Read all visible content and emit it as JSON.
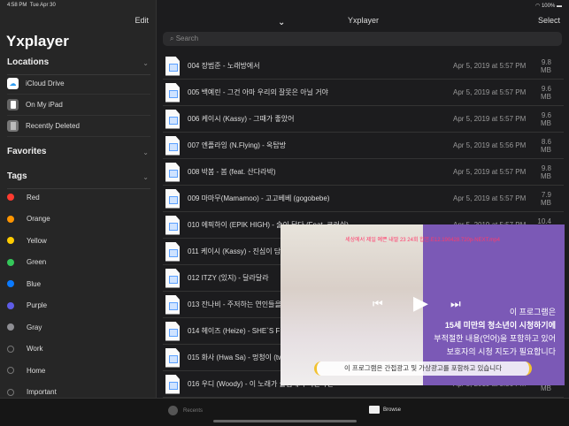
{
  "status": {
    "time": "4:58 PM",
    "date": "Tue Apr 30",
    "battery": "100%"
  },
  "sidebar": {
    "edit": "Edit",
    "title": "Yxplayer",
    "locations_header": "Locations",
    "locations": [
      {
        "label": "iCloud Drive",
        "icon": "cloud-icon"
      },
      {
        "label": "On My iPad",
        "icon": "ipad-icon"
      },
      {
        "label": "Recently Deleted",
        "icon": "trash-icon"
      }
    ],
    "favorites_header": "Favorites",
    "tags_header": "Tags",
    "tags": [
      {
        "label": "Red",
        "color": "#ff3b30"
      },
      {
        "label": "Orange",
        "color": "#ff9500"
      },
      {
        "label": "Yellow",
        "color": "#ffcc00"
      },
      {
        "label": "Green",
        "color": "#34c759"
      },
      {
        "label": "Blue",
        "color": "#0a7aff"
      },
      {
        "label": "Purple",
        "color": "#5e5ce6"
      },
      {
        "label": "Gray",
        "color": "#8e8e93"
      },
      {
        "label": "Work",
        "color": ""
      },
      {
        "label": "Home",
        "color": ""
      },
      {
        "label": "Important",
        "color": ""
      }
    ]
  },
  "main": {
    "title": "Yxplayer",
    "select": "Select",
    "search_placeholder": "Search",
    "files": [
      {
        "name": "004 장범준 - 노래방에서",
        "date": "Apr 5, 2019 at 5:57 PM",
        "size": "9.8 MB"
      },
      {
        "name": "005 백예린 - 그건 아마 우리의 잘못은 아닐 거야",
        "date": "Apr 5, 2019 at 5:57 PM",
        "size": "9.6 MB"
      },
      {
        "name": "006 케이시 (Kassy) - 그때가 좋았어",
        "date": "Apr 5, 2019 at 5:57 PM",
        "size": "9.6 MB"
      },
      {
        "name": "007 엔플라잉 (N.Flying) - 옥탑방",
        "date": "Apr 5, 2019 at 5:56 PM",
        "size": "8.6 MB"
      },
      {
        "name": "008 박봄 - 봄 (feat. 산다라박)",
        "date": "Apr 5, 2019 at 5:57 PM",
        "size": "9.8 MB"
      },
      {
        "name": "009 마마무(Mamamoo) - 고고베베 (gogobebe)",
        "date": "Apr 5, 2019 at 5:57 PM",
        "size": "7.9 MB"
      },
      {
        "name": "010 에픽하이 (EPIK HIGH) - 술이 달다 (Feat. 크러쉬)",
        "date": "Apr 5, 2019 at 5:57 PM",
        "size": "10.4 MB"
      },
      {
        "name": "011 케이시 (Kassy) - 진심이 담",
        "date": "",
        "size": ""
      },
      {
        "name": "012 ITZY (있지) - 달라달라",
        "date": "",
        "size": ""
      },
      {
        "name": "013 잔나비 - 주저하는 연인들을",
        "date": "",
        "size": ""
      },
      {
        "name": "014 헤이즈 (Heize) - SHE`S F",
        "date": "",
        "size": ""
      },
      {
        "name": "015 화사 (Hwa Sa) - 멍청이 (tw",
        "date": "",
        "size": ""
      },
      {
        "name": "016 우디 (Woody) - 이 노래가 클럽에서 나온다면",
        "date": "Apr 5, 2019 at 5:56 PM",
        "size": "8.8 MB"
      }
    ]
  },
  "video": {
    "title": "세상에서 제일 예쁜 내딸 23 24회 합본.E12.190428.720p-NEXT.mp4",
    "warning": [
      "이 프로그램은",
      "15세 미만의 청소년이 시청하기에",
      "부적절한 내용(언어)을 포함하고 있어",
      "보호자의 시청 지도가 필요합니다"
    ],
    "caption": "이 프로그램은 간접광고 및 가상광고를 포함하고 있습니다"
  },
  "tabbar": {
    "recents": "Recents",
    "browse": "Browse"
  }
}
